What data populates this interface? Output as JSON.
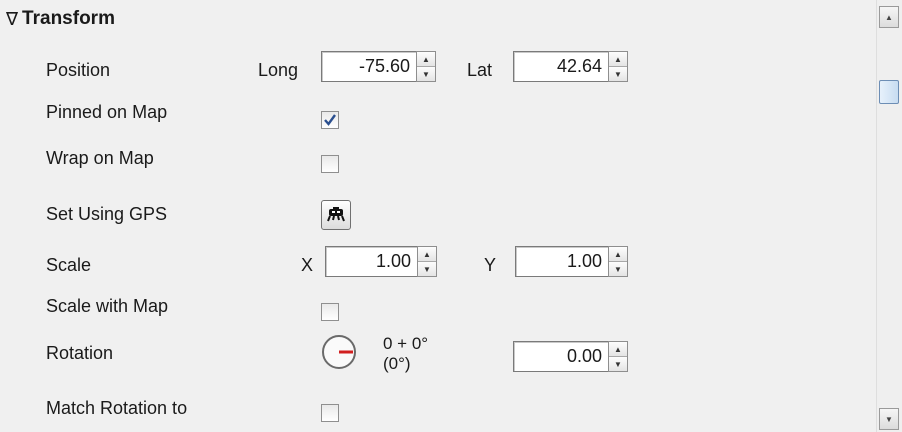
{
  "section": {
    "title": "Transform",
    "expanded_glyph": "∇"
  },
  "rows": {
    "position": {
      "label": "Position",
      "long_label": "Long",
      "long_value": "-75.60",
      "lat_label": "Lat",
      "lat_value": "42.64"
    },
    "pinned": {
      "label": "Pinned on Map",
      "checked": true
    },
    "wrap": {
      "label": "Wrap on Map",
      "checked": false
    },
    "gps": {
      "label": "Set Using GPS",
      "icon": "gps-satellite-icon"
    },
    "scale": {
      "label": "Scale",
      "x_label": "X",
      "x_value": "1.00",
      "y_label": "Y",
      "y_value": "1.00"
    },
    "scale_with_map": {
      "label": "Scale with Map",
      "checked": false
    },
    "rotation": {
      "label": "Rotation",
      "readout_line1": "0 + 0°",
      "readout_line2": "(0°)",
      "value": "0.00",
      "dial_angle_degrees": 0
    },
    "match_rotation": {
      "label": "Match Rotation to",
      "checked": false
    }
  },
  "colors": {
    "dial_needle": "#d11f1f",
    "checkmark": "#2b4f8f"
  }
}
